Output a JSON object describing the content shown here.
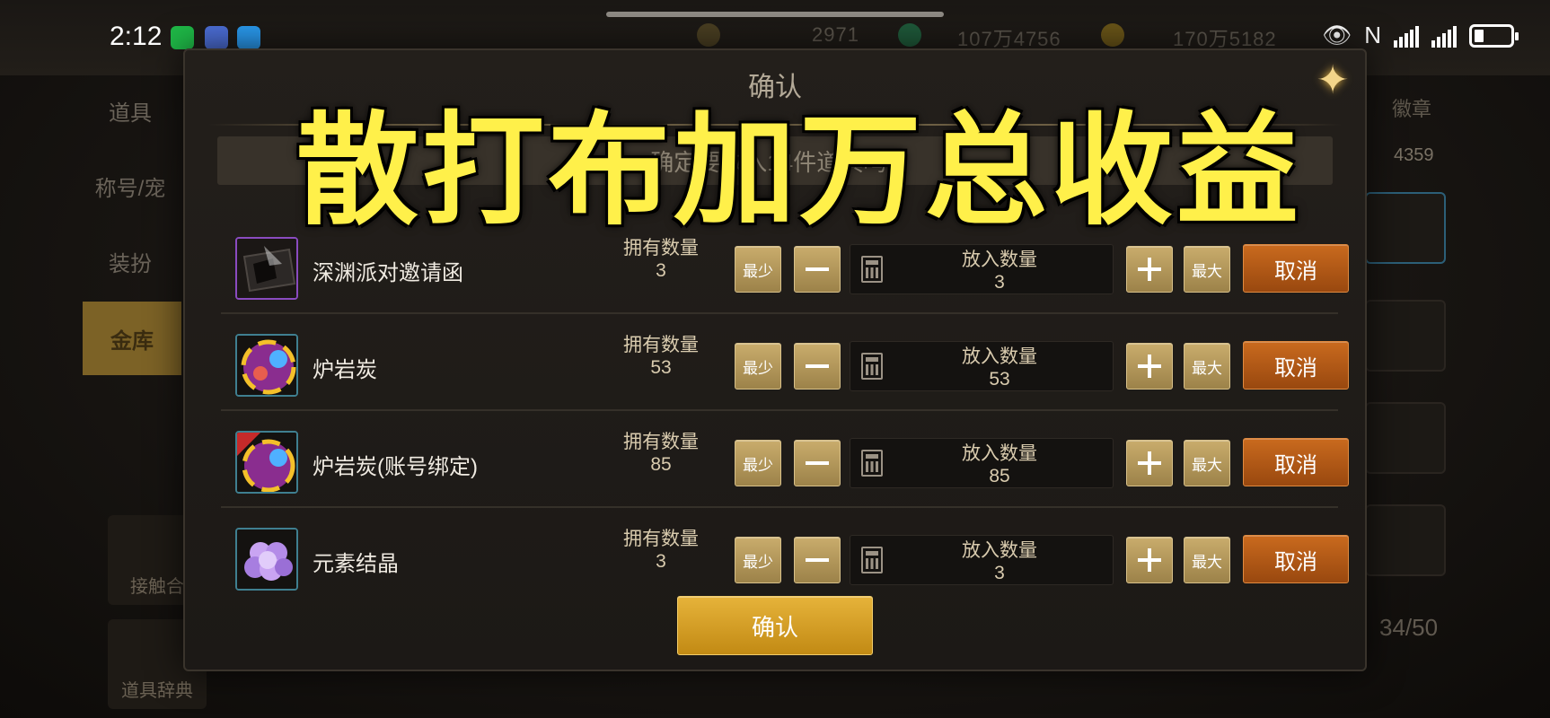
{
  "status_bar": {
    "time": "2:12",
    "network_label": "N"
  },
  "background": {
    "currencies": [
      "2971",
      "107万4756",
      "170万5182"
    ],
    "tabs": [
      "道具",
      "称号/宠",
      "装扮",
      "金库"
    ],
    "right_values": [
      "4359",
      "34/50"
    ],
    "left_cards": [
      "接触合",
      "道具辞典"
    ],
    "right_tab": "徽章"
  },
  "dialog": {
    "title": "确认",
    "prompt": "确定要放入14件道具吗?",
    "owned_label": "拥有数量",
    "put_label": "放入数量",
    "min_label": "最少",
    "max_label": "最大",
    "cancel_label": "取消",
    "confirm_label": "确认",
    "items": [
      {
        "name": "深渊派对邀请函",
        "owned": "3",
        "put": "3",
        "icon": "invitation-card-icon"
      },
      {
        "name": "炉岩炭",
        "owned": "53",
        "put": "53",
        "icon": "lava-coal-orb-icon"
      },
      {
        "name": "炉岩炭(账号绑定)",
        "owned": "85",
        "put": "85",
        "icon": "lava-coal-bound-icon"
      },
      {
        "name": "元素结晶",
        "owned": "3",
        "put": "3",
        "icon": "element-crystal-icon"
      }
    ]
  },
  "overlay_caption": "散打布加万总收益",
  "colors": {
    "caption": "#fff04a",
    "cancel": "#c96a1e",
    "confirm": "#e6b33a",
    "gold_button": "#c9ac6c"
  }
}
